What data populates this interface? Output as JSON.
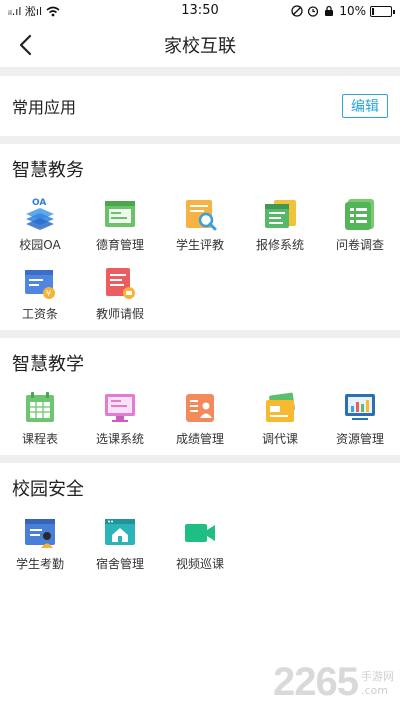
{
  "status_bar": {
    "time": "13:50",
    "battery": "10%",
    "carrier": "ᵢₗ.ıl 淞ıl",
    "battery_level": 0.1
  },
  "header": {
    "title": "家校互联"
  },
  "common": {
    "label": "常用应用",
    "edit_label": "编辑"
  },
  "sections": [
    {
      "title": "智慧教务",
      "apps": [
        {
          "label": "校园OA",
          "icon": "layers-oa-icon"
        },
        {
          "label": "德育管理",
          "icon": "window-green-icon"
        },
        {
          "label": "学生评教",
          "icon": "magnifier-doc-icon"
        },
        {
          "label": "报修系统",
          "icon": "calendar-doc-icon"
        },
        {
          "label": "问卷调查",
          "icon": "checklist-icon"
        },
        {
          "label": "工资条",
          "icon": "salary-icon"
        },
        {
          "label": "教师请假",
          "icon": "leave-icon"
        }
      ]
    },
    {
      "title": "智慧教学",
      "apps": [
        {
          "label": "课程表",
          "icon": "schedule-icon"
        },
        {
          "label": "选课系统",
          "icon": "monitor-icon"
        },
        {
          "label": "成绩管理",
          "icon": "grade-icon"
        },
        {
          "label": "调代课",
          "icon": "cards-icon"
        },
        {
          "label": "资源管理",
          "icon": "chart-monitor-icon"
        }
      ]
    },
    {
      "title": "校园安全",
      "apps": [
        {
          "label": "学生考勤",
          "icon": "attendance-icon"
        },
        {
          "label": "宿舍管理",
          "icon": "dorm-icon"
        },
        {
          "label": "视频巡课",
          "icon": "video-camera-icon"
        }
      ]
    }
  ],
  "watermark": {
    "number": "2265",
    "site": "手游网",
    "url": ".com"
  }
}
